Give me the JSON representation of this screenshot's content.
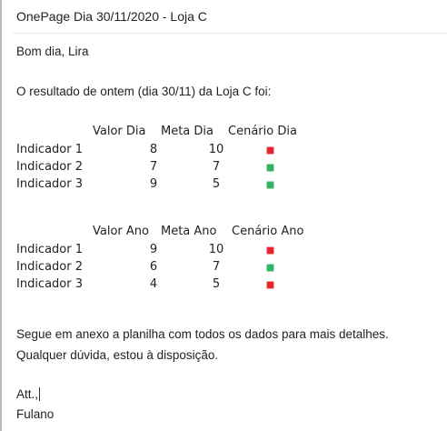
{
  "email": {
    "subject": "OnePage Dia 30/11/2020 - Loja C",
    "greeting": "Bom dia, Lira",
    "intro": "O resultado de ontem (dia 30/11) da Loja C foi:",
    "closing_line1": "Segue em anexo a planilha com todos os dados para mais detalhes.",
    "closing_line2": "Qualquer dúvida, estou à disposição.",
    "signoff": "Att.,",
    "signature": "Fulano"
  },
  "table_dia": {
    "headers": [
      "Valor Dia",
      "Meta Dia",
      "Cenário Dia"
    ],
    "rows": [
      {
        "label": "Indicador 1",
        "valor": "8",
        "meta": "10",
        "status": "red"
      },
      {
        "label": "Indicador 2",
        "valor": "7",
        "meta": "7",
        "status": "green"
      },
      {
        "label": "Indicador 3",
        "valor": "9",
        "meta": "5",
        "status": "green"
      }
    ]
  },
  "table_ano": {
    "headers": [
      "Valor Ano",
      "Meta Ano",
      "Cenário Ano"
    ],
    "rows": [
      {
        "label": "Indicador 1",
        "valor": "9",
        "meta": "10",
        "status": "red"
      },
      {
        "label": "Indicador 2",
        "valor": "6",
        "meta": "7",
        "status": "green"
      },
      {
        "label": "Indicador 3",
        "valor": "4",
        "meta": "5",
        "status": "red"
      }
    ]
  },
  "colors": {
    "red": "#e8242f",
    "green": "#2fb561"
  }
}
